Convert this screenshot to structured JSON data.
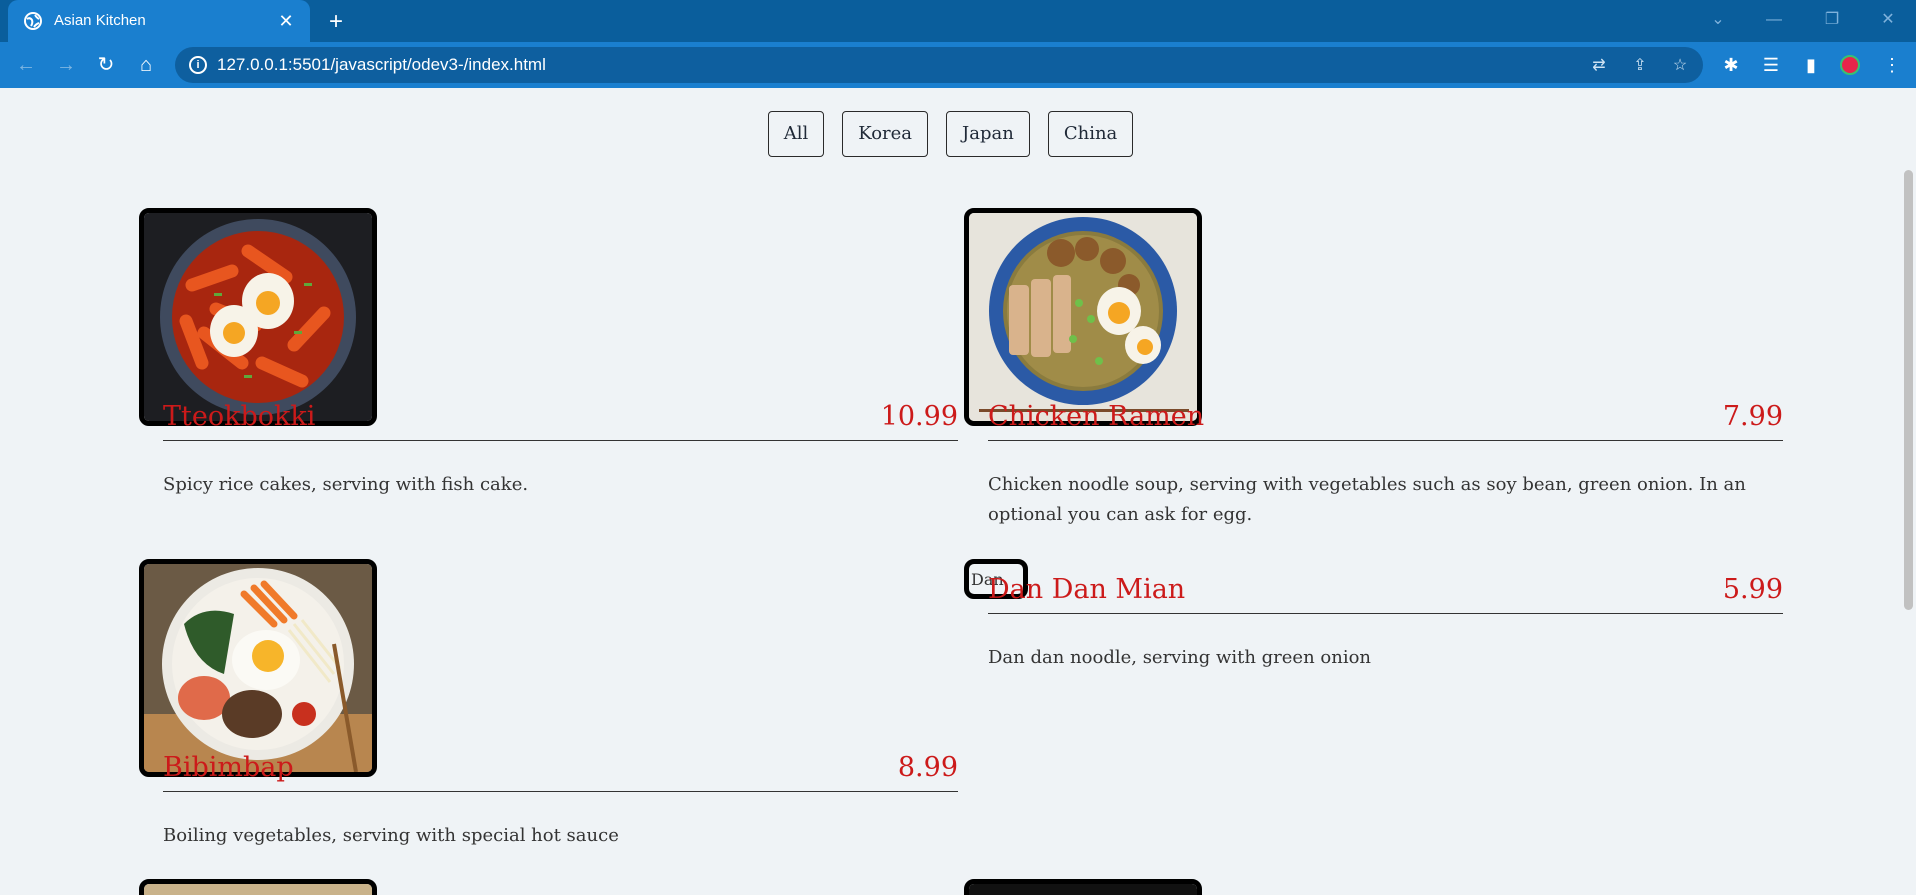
{
  "browser": {
    "tab_title": "Asian Kitchen",
    "tab_close": "✕",
    "new_tab": "+",
    "url": "127.0.0.1:5501/javascript/odev3-/index.html"
  },
  "filters": [
    "All",
    "Korea",
    "Japan",
    "China"
  ],
  "menu": [
    {
      "name": "Tteokbokki",
      "price": "10.99",
      "desc": "Spicy rice cakes, serving with fish cake.",
      "photo": "tteokbokki"
    },
    {
      "name": "Chicken Ramen",
      "price": "7.99",
      "desc": "Chicken noodle soup, serving with vegetables such as soy bean, green onion. In an optional you can ask for egg.",
      "photo": "ramen"
    },
    {
      "name": "Bibimbap",
      "price": "8.99",
      "desc": "Boiling vegetables, serving with special hot sauce",
      "photo": "bibimbap"
    },
    {
      "name": "Dan Dan Mian",
      "price": "5.99",
      "desc": "Dan dan noodle, serving with green onion",
      "photo_alt": "Dan"
    }
  ]
}
